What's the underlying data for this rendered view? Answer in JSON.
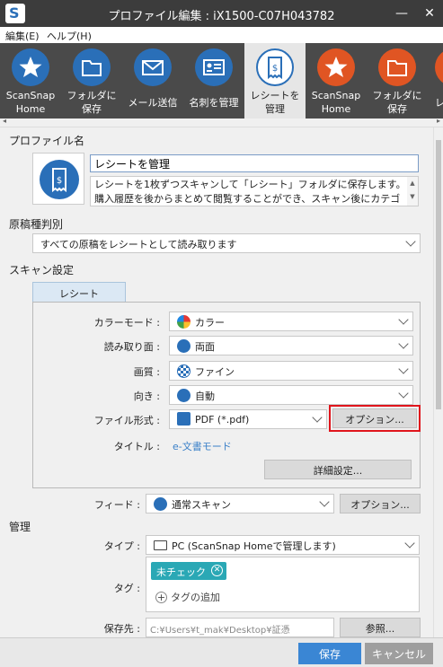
{
  "window": {
    "title": "プロファイル編集 : iX1500-C07H043782"
  },
  "menu": [
    {
      "label": "編集(E)"
    },
    {
      "label": "ヘルプ(H)"
    }
  ],
  "toolbar": [
    {
      "label1": "ScanSnap",
      "label2": "Home",
      "icon": "star-icon",
      "color": "#2a6fb8"
    },
    {
      "label1": "フォルダに",
      "label2": "保存",
      "icon": "folder-icon",
      "color": "#2a6fb8"
    },
    {
      "label1": "メール送信",
      "label2": "",
      "icon": "envelope-icon",
      "color": "#2a6fb8"
    },
    {
      "label1": "名刺を管理",
      "label2": "",
      "icon": "business-card-icon",
      "color": "#2a6fb8"
    },
    {
      "label1": "レシートを",
      "label2": "管理",
      "icon": "receipt-icon",
      "color": "#2a6fb8"
    },
    {
      "label1": "ScanSnap",
      "label2": "Home",
      "icon": "star-icon",
      "color": "#e05523"
    },
    {
      "label1": "フォルダに",
      "label2": "保存",
      "icon": "folder-icon",
      "color": "#e05523"
    },
    {
      "label1": "レ",
      "label2": "",
      "icon": "partial-icon",
      "color": "#e05523"
    }
  ],
  "profile": {
    "section_label": "プロファイル名",
    "name": "レシートを管理",
    "description_line1": "レシートを1枚ずつスキャンして「レシート」フォルダに保存します。",
    "description_line2": "購入履歴を後からまとめて閲覧することができ、スキャン後にカテゴ"
  },
  "doc_type": {
    "section_label": "原稿種判別",
    "value": "すべての原稿をレシートとして読み取ります"
  },
  "scan": {
    "section_label": "スキャン設定",
    "tab_label": "レシート",
    "color_mode": {
      "label": "カラーモード :",
      "value": "カラー"
    },
    "side": {
      "label": "読み取り面 :",
      "value": "両面"
    },
    "quality": {
      "label": "画質 :",
      "value": "ファイン"
    },
    "orientation": {
      "label": "向き :",
      "value": "自動"
    },
    "file_format": {
      "label": "ファイル形式 :",
      "value": "PDF (*.pdf)",
      "options_button": "オプション..."
    },
    "title": {
      "label": "タイトル :",
      "value": "e-文書モード"
    },
    "detail_button": "詳細設定...",
    "feed": {
      "label": "フィード :",
      "value": "通常スキャン",
      "options_button": "オプション..."
    }
  },
  "manage": {
    "section_label": "管理",
    "type": {
      "label": "タイプ :",
      "value": "PC (ScanSnap Homeで管理します)"
    },
    "tag": {
      "label": "タグ :",
      "chip": "未チェック",
      "add_label": "タグの追加"
    },
    "save_to": {
      "label": "保存先 :",
      "value": "C:¥Users¥t_mak¥Desktop¥証憑",
      "browse_button": "参照..."
    }
  },
  "footer": {
    "save": "保存",
    "cancel": "キャンセル"
  },
  "colors": {
    "accent_blue": "#2a6fb8",
    "accent_orange": "#e05523",
    "highlight_red": "#e0151c",
    "tag_teal": "#2aa8b5",
    "save_button": "#3a86d4",
    "cancel_button": "#9e9e9e"
  }
}
